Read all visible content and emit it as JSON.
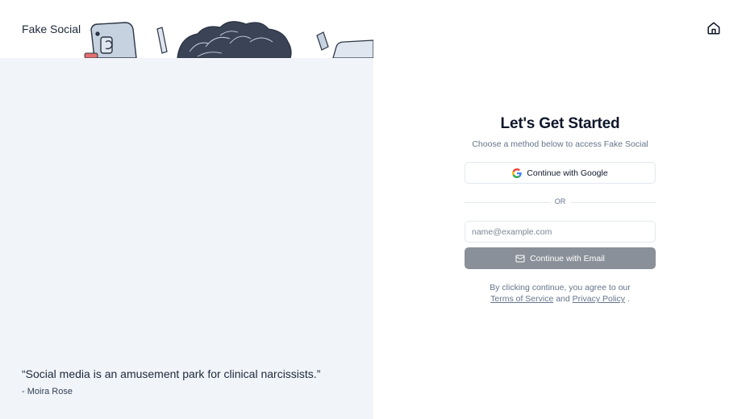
{
  "brand": {
    "name": "Fake Social"
  },
  "quote": {
    "text": "“Social media is an amusement park for clinical narcissists.”",
    "author": "- Moira Rose"
  },
  "header": {
    "home_icon": "home-icon"
  },
  "auth": {
    "title": "Let's Get Started",
    "subtitle": "Choose a method below to access Fake Social",
    "google_button": "Continue with Google",
    "divider": "OR",
    "email_placeholder": "name@example.com",
    "email_value": "",
    "email_button": "Continue with Email",
    "terms_prefix": "By clicking continue, you agree to our",
    "terms_link": "Terms of Service",
    "terms_and": "and",
    "privacy_link": "Privacy Policy",
    "terms_suffix": "."
  },
  "colors": {
    "left_panel_bg": "#f1f4f9",
    "email_button_bg": "#8a9099",
    "border": "#e2e8f0",
    "text_primary": "#0f172a",
    "text_muted": "#64748b"
  }
}
